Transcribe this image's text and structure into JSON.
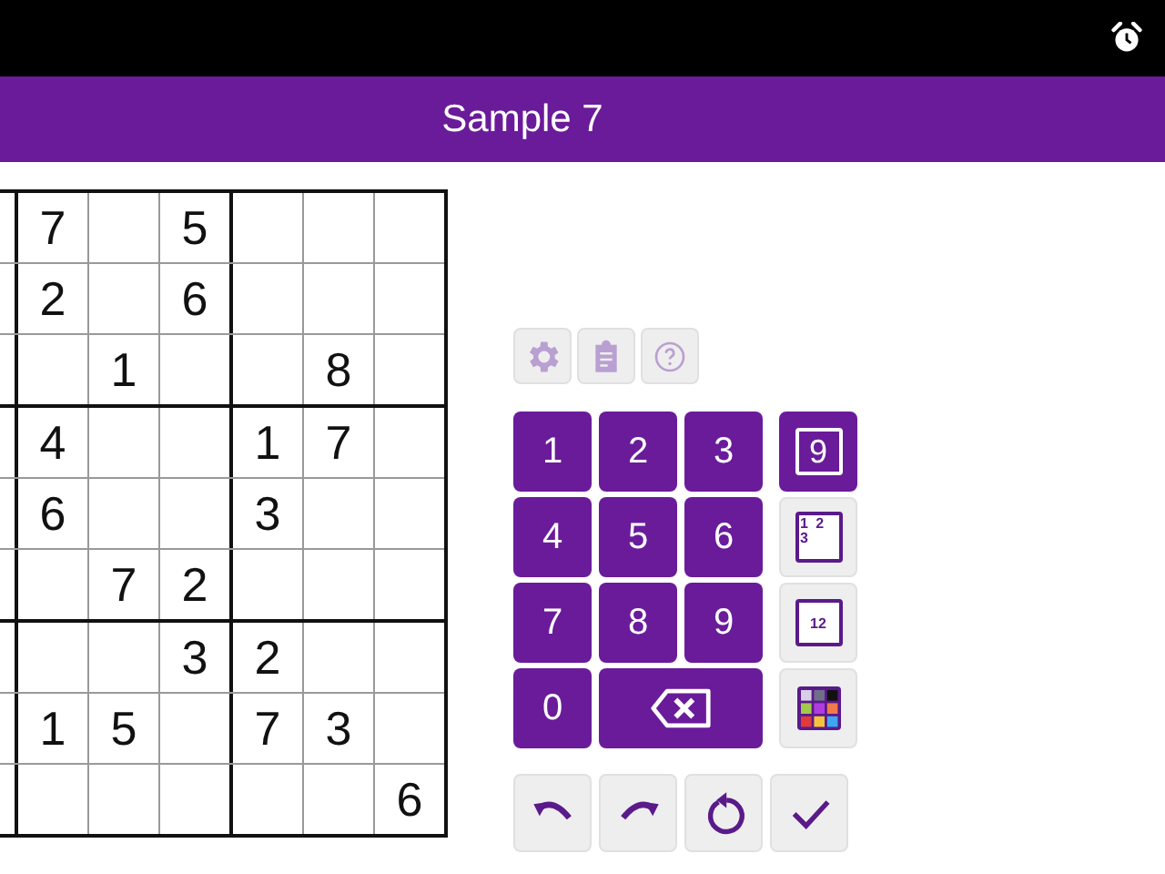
{
  "header": {
    "title": "Sample 7"
  },
  "grid": {
    "rows": [
      [
        "7",
        "",
        "5",
        "",
        "",
        ""
      ],
      [
        "2",
        "",
        "6",
        "",
        "",
        ""
      ],
      [
        "",
        "1",
        "",
        "",
        "8",
        ""
      ],
      [
        "4",
        "",
        "",
        "1",
        "7",
        ""
      ],
      [
        "6",
        "",
        "",
        "3",
        "",
        ""
      ],
      [
        "",
        "7",
        "2",
        "",
        "",
        ""
      ],
      [
        "",
        "",
        "3",
        "2",
        "",
        ""
      ],
      [
        "1",
        "5",
        "",
        "7",
        "3",
        ""
      ],
      [
        "",
        "",
        "",
        "",
        "",
        "6"
      ]
    ]
  },
  "toolbar": [
    {
      "kind": "settings",
      "disabled": true
    },
    {
      "kind": "clipboard",
      "disabled": true
    },
    {
      "kind": "help",
      "disabled": true
    }
  ],
  "keypad": [
    {
      "kind": "digit",
      "label": "1"
    },
    {
      "kind": "digit",
      "label": "2"
    },
    {
      "kind": "digit",
      "label": "3"
    },
    {
      "kind": "digit",
      "label": "4"
    },
    {
      "kind": "digit",
      "label": "5"
    },
    {
      "kind": "digit",
      "label": "6"
    },
    {
      "kind": "digit",
      "label": "7"
    },
    {
      "kind": "digit",
      "label": "8"
    },
    {
      "kind": "digit",
      "label": "9"
    },
    {
      "kind": "digit",
      "label": "0"
    },
    {
      "kind": "backspace"
    }
  ],
  "modes": [
    {
      "kind": "normal",
      "label": "9",
      "selected": true
    },
    {
      "kind": "corner",
      "labels": [
        "1",
        "2",
        "3"
      ],
      "selected": false
    },
    {
      "kind": "center",
      "label": "12",
      "selected": false
    },
    {
      "kind": "color",
      "selected": false
    }
  ],
  "actions": [
    {
      "kind": "undo"
    },
    {
      "kind": "redo"
    },
    {
      "kind": "restart"
    },
    {
      "kind": "check"
    }
  ]
}
